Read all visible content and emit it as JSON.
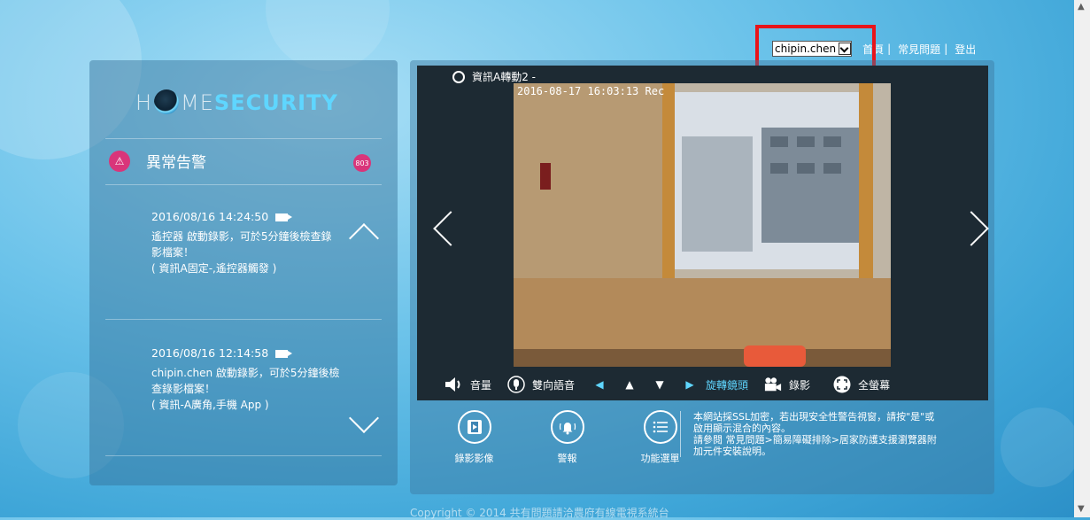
{
  "header": {
    "user_selected": "chipin.chen",
    "links": [
      "首頁",
      "常見問題",
      "登出"
    ]
  },
  "logo": {
    "part1": "H",
    "part2": "ME",
    "part3": "SECURITY"
  },
  "alarm": {
    "title": "異常告警",
    "count": "803",
    "items": [
      {
        "time": "2016/08/16 14:24:50",
        "line1": "遙控器 啟動錄影，可於5分鐘後檢查錄",
        "line2": "影檔案！",
        "line3": "( 資訊A固定-,遙控器觸發 )"
      },
      {
        "time": "2016/08/16 12:14:58",
        "line1": "chipin.chen 啟動錄影，可於5分鐘後檢",
        "line2": "查錄影檔案！",
        "line3": "( 資訊-A廣角,手機 App )"
      }
    ]
  },
  "camera": {
    "name": "資訊A轉動2 -",
    "timestamp": "2016-08-17 16:03:13 Rec"
  },
  "toolbar": {
    "volume": "音量",
    "two_way_audio": "雙向語音",
    "rotate": "旋轉鏡頭",
    "record": "錄影",
    "fullscreen": "全螢幕"
  },
  "bottom": {
    "recordings": "錄影影像",
    "alarm": "警報",
    "menu": "功能選單"
  },
  "note": {
    "line1": "本網站採SSL加密，若出現安全性警告視窗，請按\"是\"或",
    "line2": "啟用顯示混合的內容。",
    "line3": "請參閱 常見問題>簡易障礙排除>居家防護支援瀏覽器附",
    "line4": "加元件安裝說明。"
  },
  "footer": {
    "copyright": "Copyright © 2014 共有問題請洽農府有線電視系統台"
  },
  "colors": {
    "accent": "#5fd6ff",
    "alert": "#d9357a",
    "highlight": "#e8141a"
  }
}
